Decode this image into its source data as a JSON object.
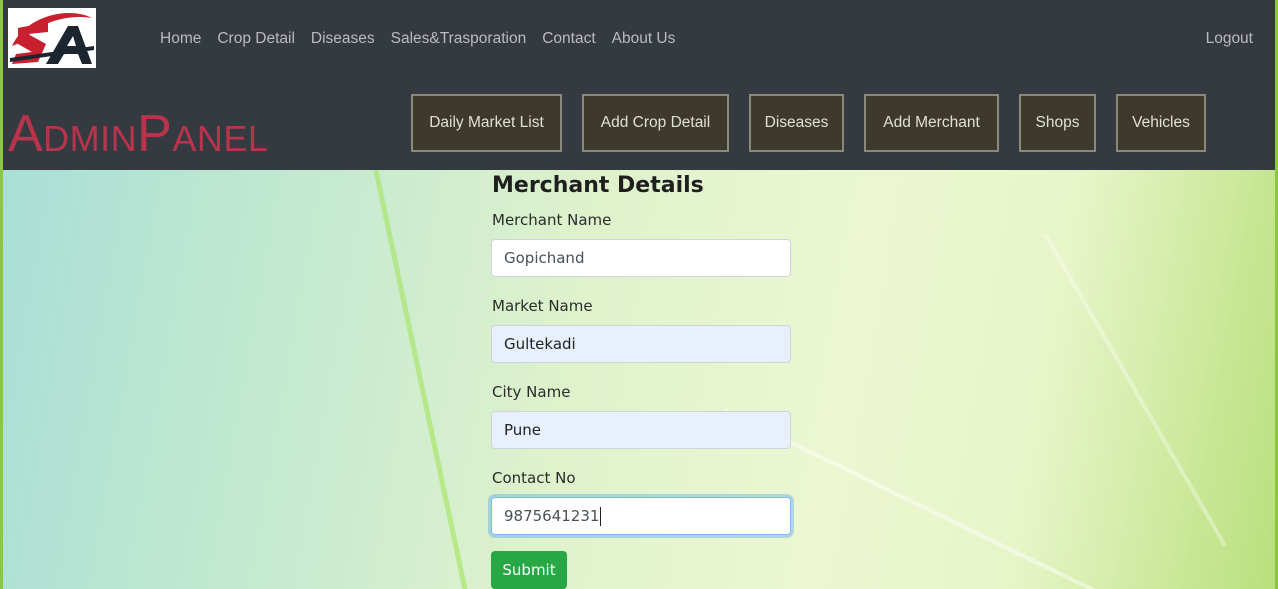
{
  "brand": {
    "logo_text": "SA",
    "admin_title": "AdminPanel",
    "colors": {
      "logo_red": "#c8202f",
      "logo_dark": "#1c2530",
      "title": "#b8344c"
    }
  },
  "nav": {
    "links": [
      "Home",
      "Crop Detail",
      "Diseases",
      "Sales&Trasporation",
      "Contact",
      "About Us"
    ],
    "logout": "Logout"
  },
  "admin_buttons": [
    "Daily Market List",
    "Add Crop Detail",
    "Diseases",
    "Add Merchant",
    "Shops",
    "Vehicles"
  ],
  "form": {
    "title": "Merchant Details",
    "fields": [
      {
        "label": "Merchant Name",
        "value": "Gopichand"
      },
      {
        "label": "Market Name",
        "value": "Gultekadi"
      },
      {
        "label": "City Name",
        "value": "Pune"
      },
      {
        "label": "Contact No",
        "value": "9875641231"
      }
    ],
    "submit": "Submit"
  },
  "colors": {
    "navbar": "#343a40",
    "button_bg": "#3d3a2c",
    "submit": "#28a745"
  }
}
